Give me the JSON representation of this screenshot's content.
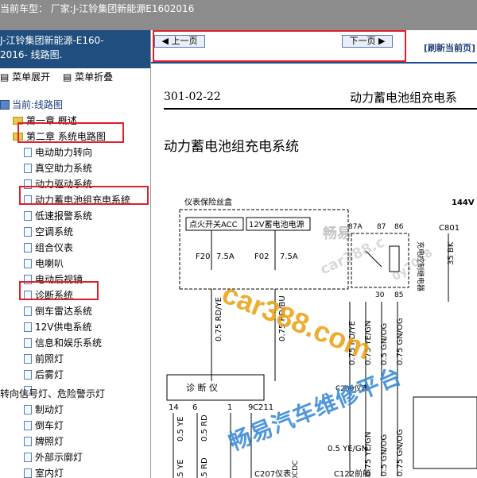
{
  "topbar": {
    "label": "当前车型： 厂家:J-江铃集团新能源E1602016"
  },
  "sidebar": {
    "header_line1": "J-江铃集团新能源-E160-",
    "header_line2": "2016- 线路图.",
    "expand_label": "菜单展开",
    "collapse_label": "菜单折叠",
    "current_label": "当前:线路图",
    "chapter1": "第一章 概述",
    "chapter2": "第二章 系统电路图",
    "items": [
      "电动助力转向",
      "真空助力系统",
      "动力驱动系统",
      "动力蓄电池组充电系统",
      "低速报警系统",
      "空调系统",
      "组合仪表",
      "电喇叭",
      "电动后视镜",
      "诊断系统",
      "倒车雷达系统",
      "12V供电系统",
      "信息和娱乐系统",
      "前照灯",
      "后雾灯",
      ""
    ],
    "group2_title": "转向信号灯、危险警示灯",
    "items2": [
      "制动灯",
      "倒车灯",
      "牌照灯",
      "外部示廓灯",
      "室内灯"
    ]
  },
  "nav": {
    "prev": "上一页",
    "next": "下一页",
    "refresh": "[刷新当前页]"
  },
  "doc": {
    "number": "301-02-22",
    "title_right": "动力蓄电池组充电系",
    "title": "动力蓄电池组充电系统",
    "schematic": {
      "fuse_box": "仪表保险丝盒",
      "acc": "点火开关ACC",
      "power12v": "12V蓄电池电源",
      "f20": "F20",
      "f20_rating": "7.5A",
      "f02": "F02",
      "f02_rating": "7.5A",
      "relay": "87A",
      "pin87": "87",
      "pin86": "86",
      "pin30": "30",
      "pin85": "85",
      "relay_label": "充电控制继电器",
      "c801": "C801",
      "v144": "144V",
      "bk": "35 BK",
      "wire1": "0.75 RD/YE",
      "wire2": "0.75 RD/BU",
      "wire3": "0.75 RD/YE",
      "wire4": "0.75 YE/GN",
      "wire5": "0.5 GN/OG",
      "wire6": "0.75 GN/OG",
      "diag": "诊 断 仪",
      "p14": "14",
      "p6": "6",
      "p1": "1",
      "p9": "9",
      "c211": "C211",
      "c209": "C209仪表",
      "d1": "0.5 YE",
      "d2": "0.5 RD",
      "d3": "0.5 YE",
      "d4": "0.5 RD",
      "yegn": "0.5 YE/GN",
      "b1": "0.75 YE/GN",
      "b2": "0.5 GN/OG",
      "b3": "0.75 GN/OG",
      "dcdc": "DCDC",
      "c207": "C207仪表",
      "c122": "C122前舱"
    }
  },
  "watermarks": {
    "cn1": "畅易",
    "site": "car388.com",
    "platform": "畅易汽车维修平台",
    "mid": "car388.c",
    "num": "0y7018"
  },
  "colors": {
    "highlight_box": "#e0202a",
    "sidebar_header": "#1f4e7f",
    "topbar": "#8c8c8c"
  }
}
